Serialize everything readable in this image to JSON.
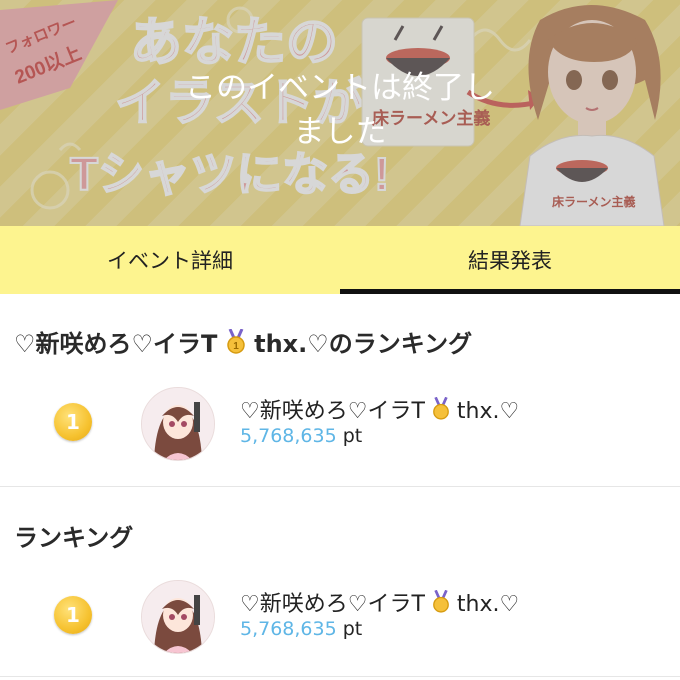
{
  "banner": {
    "overlay_lines": [
      "このイベントは終了し",
      "ました"
    ],
    "follower_tag": [
      "フォロワー",
      "200以上"
    ],
    "headline_lines": [
      "あなたの",
      "イラストが",
      "Tシャツになる!"
    ],
    "shirt_label": "床ラーメン主義"
  },
  "tabs": [
    {
      "label": "イベント詳細",
      "active": false
    },
    {
      "label": "結果発表",
      "active": true
    }
  ],
  "user_ranking": {
    "title_prefix": "♡新咲めろ♡イラT",
    "title_suffix": "thx.♡のランキング",
    "entries": [
      {
        "rank": "1",
        "name_prefix": "♡新咲めろ♡イラT",
        "name_suffix": "thx.♡",
        "points": "5,768,635",
        "unit": "pt"
      }
    ]
  },
  "ranking": {
    "title": "ランキング",
    "entries": [
      {
        "rank": "1",
        "name_prefix": "♡新咲めろ♡イラT",
        "name_suffix": "thx.♡",
        "points": "5,768,635",
        "unit": "pt"
      }
    ]
  },
  "colors": {
    "tab_bar": "#fdf48f",
    "points": "#5fb6e6",
    "rank_gold": "#f6c230"
  },
  "icons": {
    "rank_badge": "gold-circle",
    "title_emoji": "medal-icon",
    "avatar": "anime-girl-avatar"
  }
}
